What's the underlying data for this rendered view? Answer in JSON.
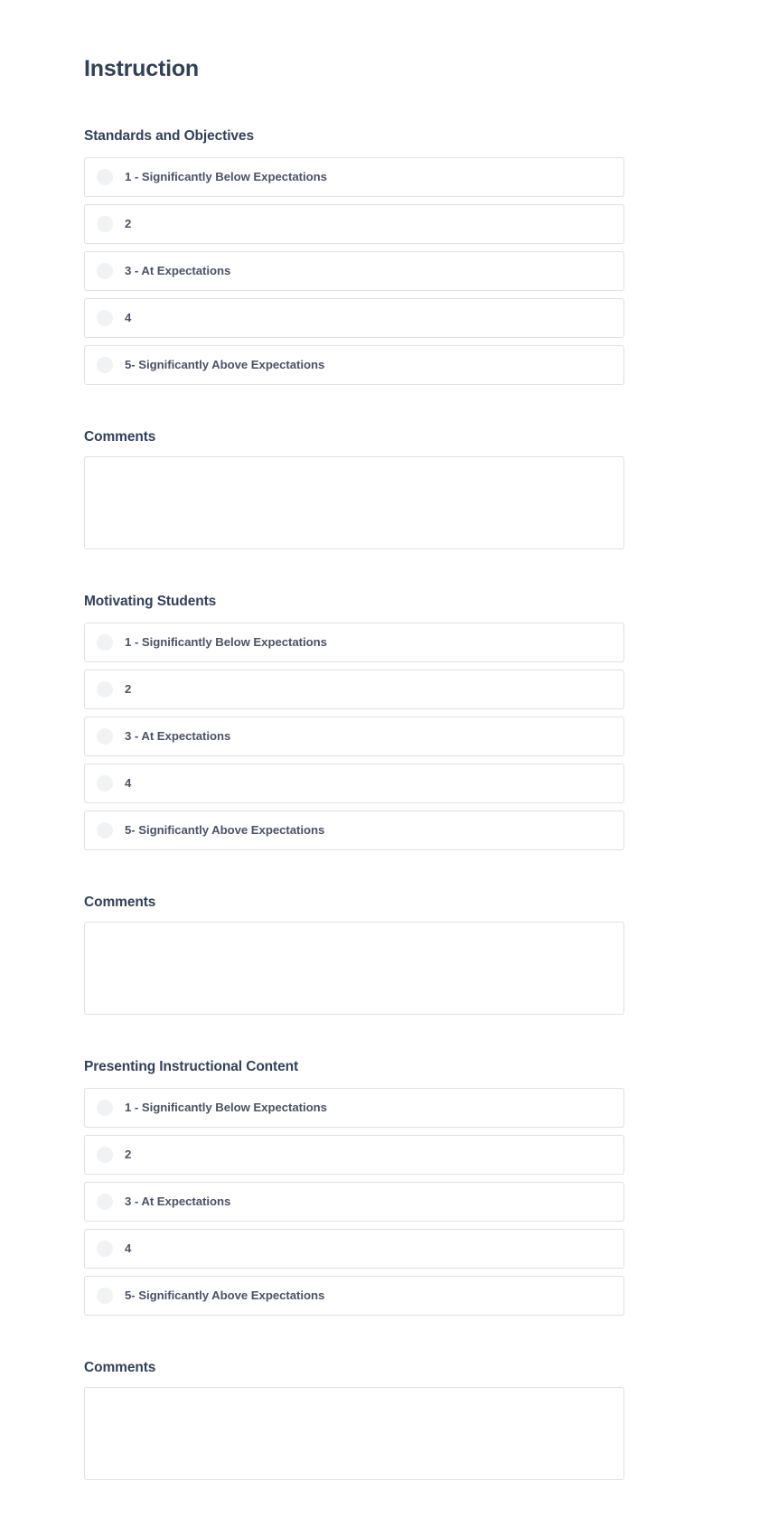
{
  "page": {
    "title": "Instruction",
    "accent_text_color": "#32415a",
    "label_text_color": "#4a5365",
    "border_color": "#dfe1e4",
    "radio_fill_color": "#f1f2f4",
    "background_color": "#ffffff"
  },
  "comments_label": "Comments",
  "comments_placeholder": "",
  "sections": [
    {
      "header": "Standards and Objectives",
      "options": [
        "1 - Significantly Below Expectations",
        "2",
        "3 - At Expectations",
        "4",
        "5- Significantly Above Expectations"
      ],
      "comments_label": "Comments",
      "comments_value": ""
    },
    {
      "header": "Motivating Students",
      "options": [
        "1 - Significantly Below Expectations",
        "2",
        "3 - At Expectations",
        "4",
        "5- Significantly Above Expectations"
      ],
      "comments_label": "Comments",
      "comments_value": ""
    },
    {
      "header": "Presenting Instructional Content",
      "options": [
        "1 - Significantly Below Expectations",
        "2",
        "3 - At Expectations",
        "4",
        "5- Significantly Above Expectations"
      ],
      "comments_label": "Comments",
      "comments_value": ""
    }
  ]
}
